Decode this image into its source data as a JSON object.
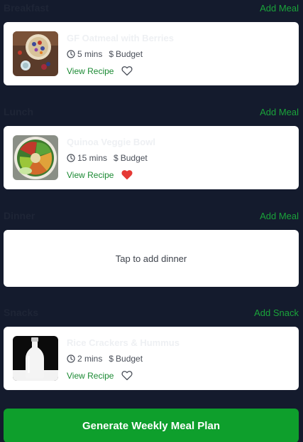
{
  "colors": {
    "background": "#141b2d",
    "accent_green": "#1aa33a",
    "cta_green": "#0e9f2c",
    "heart_red": "#e53935",
    "card": "#ffffff"
  },
  "sections": {
    "breakfast": {
      "title": "Breakfast",
      "action": "Add Meal",
      "meal": {
        "name": "GF Oatmeal with Berries",
        "time": "5 mins",
        "cost": "Budget",
        "view_label": "View Recipe",
        "favorited": false,
        "image_icon": "oatmeal-photo"
      }
    },
    "lunch": {
      "title": "Lunch",
      "action": "Add Meal",
      "meal": {
        "name": "Quinoa Veggie Bowl",
        "time": "15 mins",
        "cost": "Budget",
        "view_label": "View Recipe",
        "favorited": true,
        "image_icon": "veggie-bowl-photo"
      }
    },
    "dinner": {
      "title": "Dinner",
      "action": "Add Meal",
      "empty_text": "Tap to add dinner"
    },
    "snacks": {
      "title": "Snacks",
      "action": "Add Snack",
      "meal": {
        "name": "Rice Crackers & Hummus",
        "time": "2 mins",
        "cost": "Budget",
        "view_label": "View Recipe",
        "favorited": false,
        "image_icon": "milk-bottle-photo"
      }
    }
  },
  "cta": {
    "label": "Generate Weekly Meal Plan"
  }
}
